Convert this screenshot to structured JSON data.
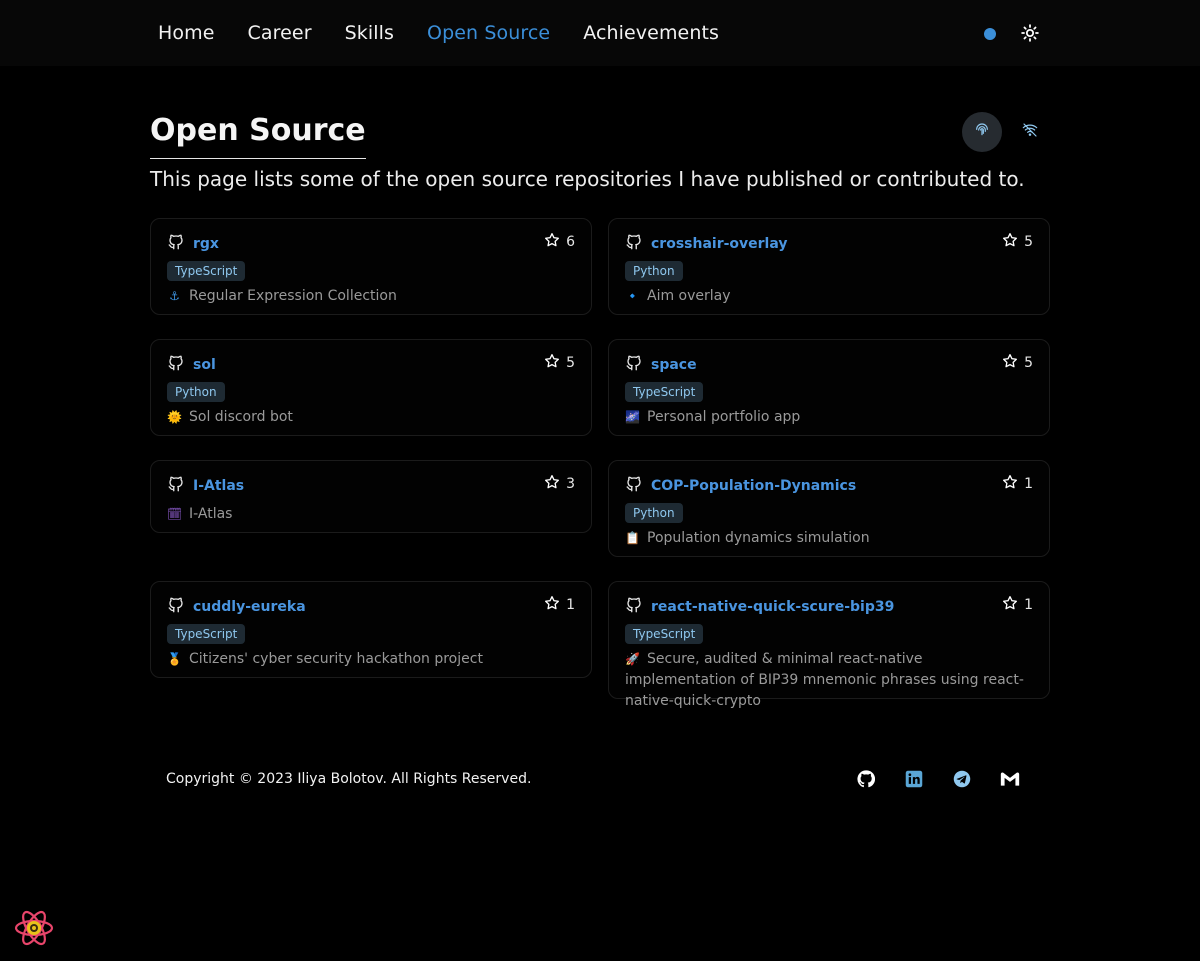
{
  "nav": {
    "items": [
      {
        "label": "Home",
        "active": false
      },
      {
        "label": "Career",
        "active": false
      },
      {
        "label": "Skills",
        "active": false
      },
      {
        "label": "Open Source",
        "active": true
      },
      {
        "label": "Achievements",
        "active": false
      }
    ],
    "icons": [
      "status-dot-icon",
      "sun-icon"
    ]
  },
  "header": {
    "title": "Open Source",
    "description": "This page lists some of the open source repositories I have published or contributed to.",
    "icons": [
      "fingerprint-icon",
      "wifi-off-icon"
    ]
  },
  "repos": [
    {
      "name": "rgx",
      "stars": "6",
      "language": "TypeScript",
      "emoji": "⚓",
      "description": "Regular Expression Collection"
    },
    {
      "name": "crosshair-overlay",
      "stars": "5",
      "language": "Python",
      "emoji": "🔹",
      "description": "Aim overlay"
    },
    {
      "name": "sol",
      "stars": "5",
      "language": "Python",
      "emoji": "🌞",
      "description": "Sol discord bot"
    },
    {
      "name": "space",
      "stars": "5",
      "language": "TypeScript",
      "emoji": "🌌",
      "description": "Personal portfolio app"
    },
    {
      "name": "I-Atlas",
      "stars": "3",
      "language": "",
      "emoji": "🗓",
      "description": "I-Atlas"
    },
    {
      "name": "COP-Population-Dynamics",
      "stars": "1",
      "language": "Python",
      "emoji": "📋",
      "description": "Population dynamics simulation"
    },
    {
      "name": "cuddly-eureka",
      "stars": "1",
      "language": "TypeScript",
      "emoji": "🏅",
      "description": "Citizens' cyber security hackathon project"
    },
    {
      "name": "react-native-quick-scure-bip39",
      "stars": "1",
      "language": "TypeScript",
      "emoji": "🚀",
      "description": "Secure, audited & minimal react-native implementation of BIP39 mnemonic phrases using react-native-quick-crypto"
    }
  ],
  "footer": {
    "copyright": "Copyright © 2023 Iliya Bolotov. All Rights Reserved.",
    "social_icons": [
      "github-icon",
      "linkedin-icon",
      "telegram-icon",
      "gmail-icon"
    ]
  },
  "colors": {
    "background": "#000000",
    "accent": "#3b8fd9",
    "repo_link": "#4a95e0",
    "tag_bg": "#1e2a33",
    "tag_text": "#8fc8ef"
  }
}
